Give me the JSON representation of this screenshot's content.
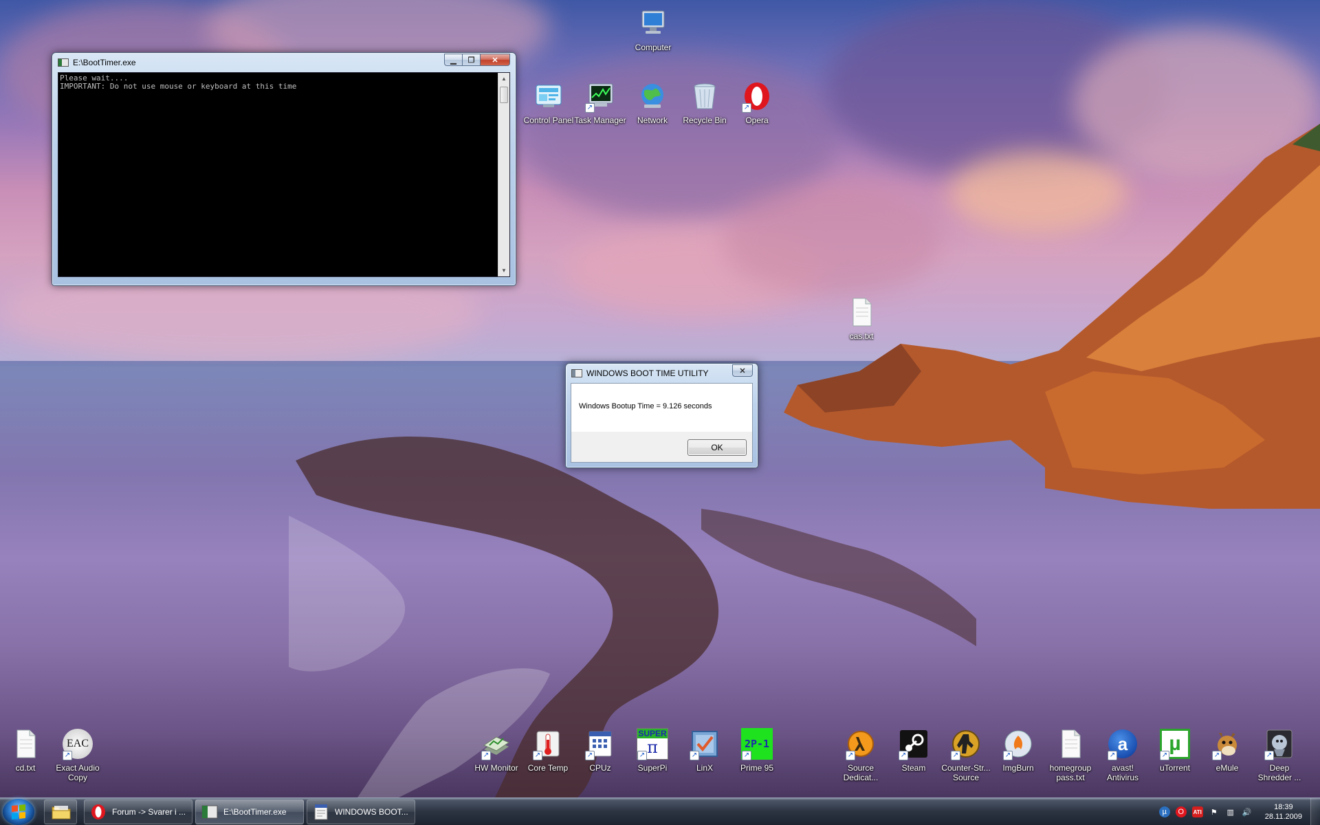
{
  "desktop": {
    "top_icons": [
      {
        "label": "Computer",
        "icon": "computer-icon"
      },
      {
        "label": "Control Panel",
        "icon": "control-panel-icon"
      },
      {
        "label": "Task Manager",
        "icon": "task-manager-icon"
      },
      {
        "label": "Network",
        "icon": "network-icon"
      },
      {
        "label": "Recycle Bin",
        "icon": "recycle-bin-icon"
      },
      {
        "label": "Opera",
        "icon": "opera-icon"
      },
      {
        "label": "cas.txt",
        "icon": "text-file-icon"
      }
    ],
    "bottom_icons": [
      {
        "label": "cd.txt",
        "icon": "text-file-icon"
      },
      {
        "label": "Exact Audio Copy",
        "icon": "eac-icon",
        "glyph_text": "EAC"
      },
      {
        "label": "HW Monitor",
        "icon": "hw-monitor-icon"
      },
      {
        "label": "Core Temp",
        "icon": "core-temp-icon"
      },
      {
        "label": "CPUz",
        "icon": "cpuz-icon"
      },
      {
        "label": "SuperPi",
        "icon": "superpi-icon",
        "glyph_text": "SUPER"
      },
      {
        "label": "LinX",
        "icon": "linx-icon"
      },
      {
        "label": "Prime 95",
        "icon": "prime95-icon",
        "glyph_text": "2P-1"
      },
      {
        "label": "Source Dedicat...",
        "icon": "source-dedicated-icon"
      },
      {
        "label": "Steam",
        "icon": "steam-icon"
      },
      {
        "label": "Counter-Str... Source",
        "icon": "counter-strike-icon"
      },
      {
        "label": "ImgBurn",
        "icon": "imgburn-icon"
      },
      {
        "label": "homegroup pass.txt",
        "icon": "text-file-icon"
      },
      {
        "label": "avast! Antivirus",
        "icon": "avast-icon",
        "glyph_text": "a"
      },
      {
        "label": "uTorrent",
        "icon": "utorrent-icon",
        "glyph_text": "µ"
      },
      {
        "label": "eMule",
        "icon": "emule-icon"
      },
      {
        "label": "Deep Shredder ...",
        "icon": "deep-shredder-icon"
      }
    ]
  },
  "console_window": {
    "title": "E:\\BootTimer.exe",
    "lines": "Please wait....\nIMPORTANT: Do not use mouse or keyboard at this time"
  },
  "dialog": {
    "title": "WINDOWS BOOT TIME UTILITY",
    "message": "Windows Bootup Time =  9.126  seconds",
    "ok_label": "OK"
  },
  "taskbar": {
    "items": [
      {
        "label": "Forum -> Svarer i ...",
        "icon": "opera-icon",
        "active": false
      },
      {
        "label": "E:\\BootTimer.exe",
        "icon": "console-icon",
        "active": true
      },
      {
        "label": "WINDOWS BOOT...",
        "icon": "dialog-app-icon",
        "active": false
      }
    ],
    "clock": {
      "time": "18:39",
      "date": "28.11.2009"
    }
  },
  "colors": {
    "console_background": "#000000",
    "console_text": "#c0c0c0",
    "close_button": "#c1402b",
    "taskbar": "#1d2430"
  }
}
